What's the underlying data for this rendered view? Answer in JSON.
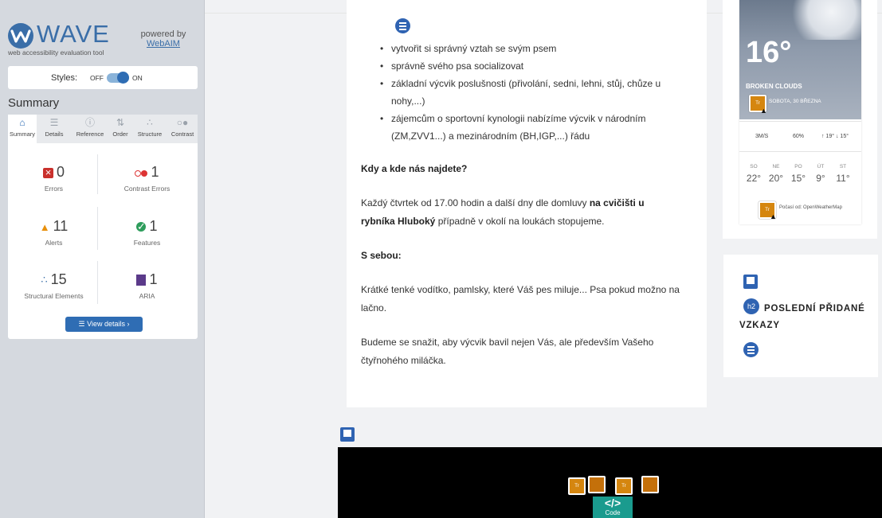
{
  "wave": {
    "logo_text": "WAVE",
    "tagline": "web accessibility evaluation tool",
    "powered_by": "powered by",
    "webaim_link": "WebAIM",
    "styles_label": "Styles:",
    "styles_off": "OFF",
    "styles_on": "ON",
    "summary_title": "Summary",
    "tabs": [
      {
        "label": "Summary",
        "icon": "home-icon"
      },
      {
        "label": "Details",
        "icon": "list-icon"
      },
      {
        "label": "Reference",
        "icon": "info-icon"
      },
      {
        "label": "Order",
        "icon": "order-icon"
      },
      {
        "label": "Structure",
        "icon": "structure-icon"
      },
      {
        "label": "Contrast",
        "icon": "contrast-icon"
      }
    ],
    "stats": {
      "errors": {
        "count": "0",
        "label": "Errors"
      },
      "contrast_errors": {
        "count": "1",
        "label": "Contrast Errors"
      },
      "alerts": {
        "count": "11",
        "label": "Alerts"
      },
      "features": {
        "count": "1",
        "label": "Features"
      },
      "structural": {
        "count": "15",
        "label": "Structural Elements"
      },
      "aria": {
        "count": "1",
        "label": "ARIA"
      }
    },
    "view_details": "View details ›",
    "accent": "#2f6db4"
  },
  "content": {
    "bullets": [
      "vytvořit si správný vztah se svým psem",
      "správně svého psa socializovat",
      "základní výcvik poslušnosti (přivolání, sedni, lehni, stůj, chůze u nohy,...)",
      "zájemcům o  sportovní  kynologii  nabízíme výcvik v národním (ZM,ZVV1...) a  mezinárodním (BH,IGP,...) řádu"
    ],
    "heading_where": "Kdy a kde nás najdete?",
    "para_where_1": "Každý čtvrtek od 17.00 hodin a další dny dle domluvy",
    "para_where_bold": "na cvičišti u rybníka Hluboký",
    "para_where_2": "případně v okolí na loukách stopujeme.",
    "heading_bring": "S sebou:",
    "para_bring": "Krátké tenké vodítko, pamlsky, které Váš pes miluje...  Psa pokud možno na lačno.",
    "para_end": "Budeme se snažit, aby výcvik bavil nejen Vás, ale především Vašeho čtyřnohého miláčka."
  },
  "weather": {
    "temp": "16°",
    "condition": "BROKEN CLOUDS",
    "date": "SOBOTA, 30 BŘEZNA",
    "wind": "3M/S",
    "humidity": "60%",
    "minmax": "↑ 19° ↓ 15°",
    "forecast": [
      {
        "day": "SO",
        "temp": "22°"
      },
      {
        "day": "NE",
        "temp": "20°"
      },
      {
        "day": "PO",
        "temp": "15°"
      },
      {
        "day": "ÚT",
        "temp": "9°"
      },
      {
        "day": "ST",
        "temp": "11°"
      }
    ],
    "source": "Počasí od: OpenWeatherMap",
    "badge_text": "Tr"
  },
  "vzkazy": {
    "h2_badge": "h2",
    "title": "POSLEDNÍ PŘIDANÉ VZKAZY"
  },
  "footer": {
    "code_label": "</>",
    "code_sub": "Code",
    "badge_text": "Tr"
  }
}
